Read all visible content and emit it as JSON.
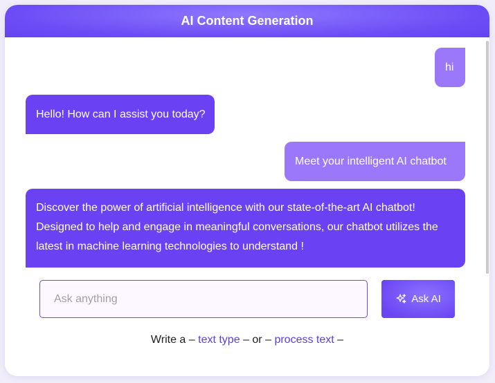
{
  "header": {
    "title": "AI Content Generation"
  },
  "colors": {
    "accent": "#6a42f4",
    "user_bubble": "#9b78fa",
    "link": "#5b3ee0"
  },
  "messages": [
    {
      "role": "user",
      "text": "hi"
    },
    {
      "role": "bot",
      "text": "Hello! How can I assist you today?"
    },
    {
      "role": "user",
      "text": "Meet your intelligent AI chatbot"
    },
    {
      "role": "bot",
      "text": "Discover the power of artificial intelligence with our state-of-the-art AI chatbot! Designed to help and engage in meaningful conversations, our chatbot utilizes the latest in machine learning technologies to understand !"
    }
  ],
  "composer": {
    "placeholder": "Ask anything",
    "value": "",
    "button_label": "Ask AI",
    "button_icon": "sparkles-icon"
  },
  "footer": {
    "prefix": "Write a",
    "dash1": "–",
    "link1": "text type",
    "dash2": "– or –",
    "link2": "process text",
    "dash3": "–"
  }
}
